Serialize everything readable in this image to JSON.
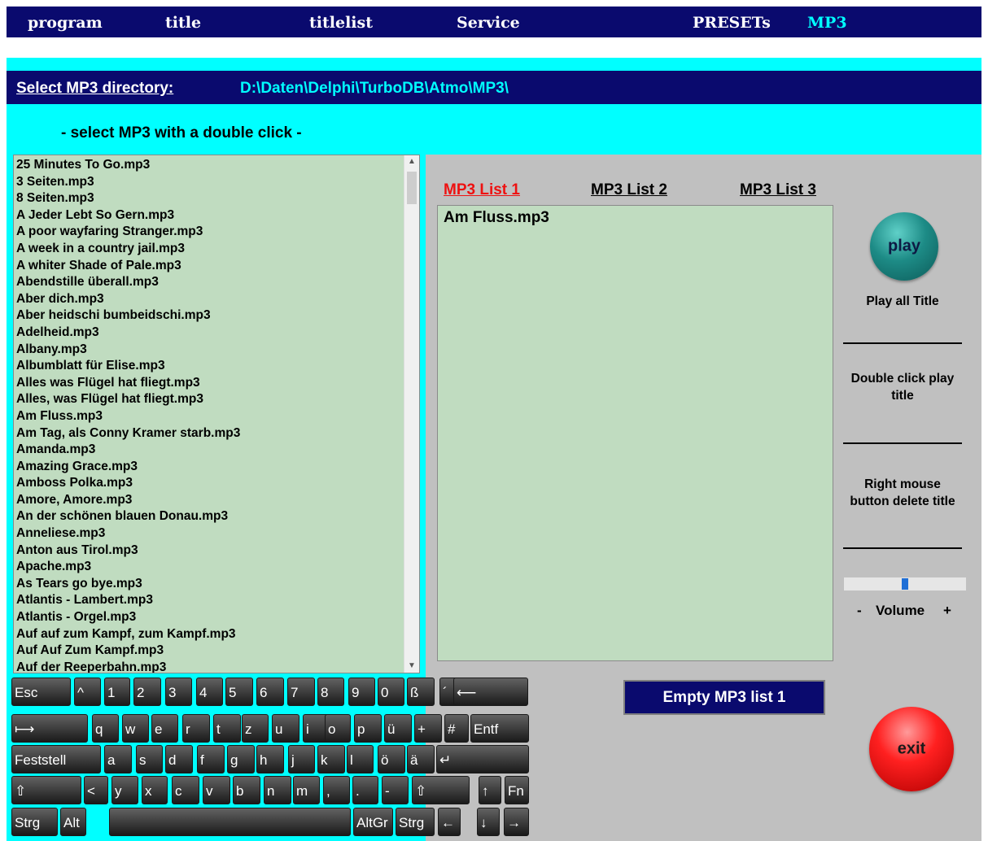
{
  "menu": {
    "items": [
      {
        "label": "program"
      },
      {
        "label": "title"
      },
      {
        "label": "titlelist"
      },
      {
        "label": "Service"
      },
      {
        "label": "PRESETs"
      },
      {
        "label": "MP3"
      }
    ],
    "active": "MP3"
  },
  "directory": {
    "label": "Select MP3 directory:",
    "path": "D:\\Daten\\Delphi\\TurboDB\\Atmo\\MP3\\"
  },
  "hint": "- select MP3 with a double click -",
  "file_list": [
    "25 Minutes To Go.mp3",
    "3 Seiten.mp3",
    "8 Seiten.mp3",
    "A Jeder Lebt So Gern.mp3",
    "A poor wayfaring Stranger.mp3",
    "A week in a country jail.mp3",
    "A whiter Shade of Pale.mp3",
    "Abendstille überall.mp3",
    "Aber dich.mp3",
    "Aber heidschi bumbeidschi.mp3",
    "Adelheid.mp3",
    "Albany.mp3",
    "Albumblatt für Elise.mp3",
    "Alles was Flügel hat fliegt.mp3",
    "Alles, was Flügel hat fliegt.mp3",
    "Am Fluss.mp3",
    "Am Tag, als Conny Kramer starb.mp3",
    "Amanda.mp3",
    "Amazing Grace.mp3",
    "Amboss Polka.mp3",
    "Amore, Amore.mp3",
    "An der schönen blauen Donau.mp3",
    "Anneliese.mp3",
    "Anton aus Tirol.mp3",
    "Apache.mp3",
    "As Tears go bye.mp3",
    "Atlantis - Lambert.mp3",
    "Atlantis - Orgel.mp3",
    "Auf auf zum Kampf, zum Kampf.mp3",
    "Auf Auf Zum Kampf.mp3",
    "Auf der Reeperbahn.mp3"
  ],
  "scrollbar": {
    "up_icon": "▲",
    "down_icon": "▼"
  },
  "tabs": [
    {
      "label": "MP3  List 1",
      "active": true
    },
    {
      "label": "MP3  List 2",
      "active": false
    },
    {
      "label": "MP3  List 3",
      "active": false
    }
  ],
  "mp3_list_1": [
    "Am Fluss.mp3"
  ],
  "controls": {
    "play_label": "play",
    "play_all": "Play all Title",
    "double_click": "Double click play title",
    "right_mouse": "Right mouse button delete title",
    "volume_minus": "-",
    "volume_label": "Volume",
    "volume_plus": "+",
    "volume_level": 0.53,
    "empty_button": "Empty MP3 list 1",
    "exit_label": "exit"
  },
  "keyboard": {
    "rows": [
      [
        "Esc",
        "^",
        "1",
        "2",
        "3",
        "4",
        "5",
        "6",
        "7",
        "8",
        "9",
        "0",
        "ß",
        "´",
        "⟵"
      ],
      [
        "⟼",
        "q",
        "w",
        "e",
        "r",
        "t",
        "z",
        "u",
        "i",
        "o",
        "p",
        "ü",
        "+",
        "#",
        "Entf"
      ],
      [
        "Feststell",
        "a",
        "s",
        "d",
        "f",
        "g",
        "h",
        "j",
        "k",
        "l",
        "ö",
        "ä",
        "↵"
      ],
      [
        "⇧",
        "<",
        "y",
        "x",
        "c",
        "v",
        "b",
        "n",
        "m",
        ",",
        ".",
        "-",
        "⇧",
        "↑",
        "Fn"
      ],
      [
        "Strg",
        "Alt",
        "",
        "AltGr",
        "Strg",
        "←",
        "↓",
        "→"
      ]
    ]
  },
  "colors": {
    "menu_bg": "#0a0a6e",
    "cyan_bg": "#00ffff",
    "list_bg": "#c0dcc0",
    "panel_bg": "#c0c0c0",
    "active_tab": "#ee1111",
    "play_button": "#1d8b86",
    "exit_button": "#ff2020"
  }
}
